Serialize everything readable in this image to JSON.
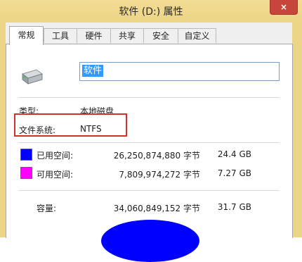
{
  "window": {
    "title": "软件 (D:) 属性",
    "close_glyph": "×"
  },
  "tabs": [
    {
      "label": "常规",
      "active": true
    },
    {
      "label": "工具",
      "active": false
    },
    {
      "label": "硬件",
      "active": false
    },
    {
      "label": "共享",
      "active": false
    },
    {
      "label": "安全",
      "active": false
    },
    {
      "label": "自定义",
      "active": false
    }
  ],
  "general": {
    "drive_name": "软件",
    "type_label": "类型:",
    "type_value": "本地磁盘",
    "fs_label": "文件系统:",
    "fs_value": "NTFS",
    "used": {
      "label": "已用空间:",
      "bytes": "26,250,874,880 字节",
      "size": "24.4 GB",
      "color": "#0000ff"
    },
    "free": {
      "label": "可用空间:",
      "bytes": "7,809,974,272 字节",
      "size": "7.27 GB",
      "color": "#ff00ff"
    },
    "capacity": {
      "label": "容量:",
      "bytes": "34,060,849,152 字节",
      "size": "31.7 GB"
    }
  }
}
